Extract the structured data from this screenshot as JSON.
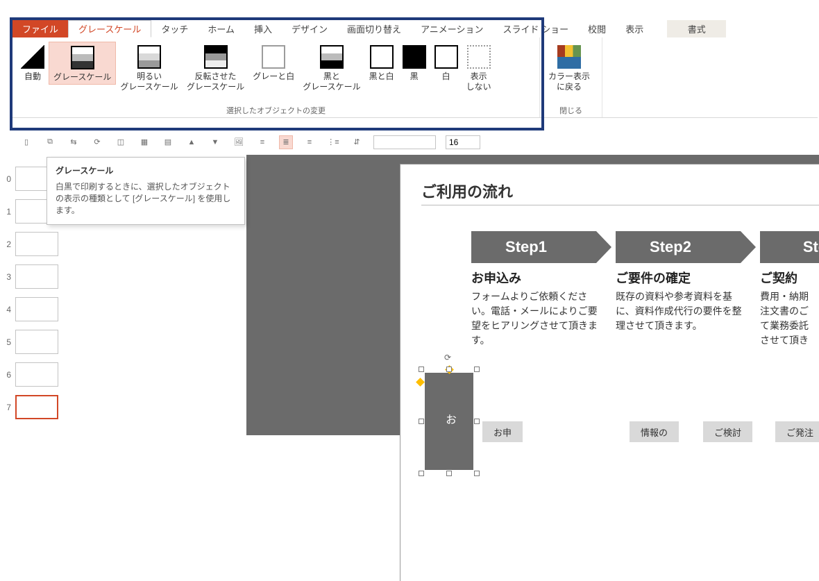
{
  "tabs": {
    "file": "ファイル",
    "grayscale": "グレースケール",
    "touch": "タッチ",
    "home": "ホーム",
    "insert": "挿入",
    "design": "デザイン",
    "transition": "画面切り替え",
    "animation": "アニメーション",
    "slideshow": "スライド ショー",
    "review": "校閲",
    "view": "表示",
    "format": "書式"
  },
  "ribbon": {
    "group1_caption": "選択したオブジェクトの変更",
    "group2_caption": "閉じる",
    "auto": "自動",
    "grayscale": "グレースケール",
    "light_grayscale": "明るい\nグレースケール",
    "inverse_grayscale": "反転させた\nグレースケール",
    "gray_with_white": "グレーと白",
    "black_with_gs": "黒と\nグレースケール",
    "black_with_white": "黒と白",
    "black": "黒",
    "white": "白",
    "dont_show": "表示\nしない",
    "back_to_color": "カラー表示\nに戻る"
  },
  "tooltip": {
    "title": "グレースケール",
    "body": "白黒で印刷するときに、選択したオブジェクトの表示の種類として [グレースケール] を使用します。"
  },
  "thumbs": [
    "0",
    "1",
    "2",
    "3",
    "4",
    "5",
    "6",
    "7"
  ],
  "mini": {
    "font_size": "16"
  },
  "slide": {
    "title": "ご利用の流れ",
    "step_labels": {
      "s1": "Step1",
      "s2": "Step2",
      "s3": "Ste"
    },
    "step_heads": {
      "s1": "お申込み",
      "s2": "ご要件の確定",
      "s3": "ご契約"
    },
    "step_bodies": {
      "s1": "フォームよりご依頼ください。電話・メールによりご要望をヒアリングさせて頂きます。",
      "s2": "既存の資料や参考資料を基に、資料作成代行の要件を整理させて頂きます。",
      "s3": "費用・納期\n注文書のご\nて業務委託\nさせて頂き"
    },
    "vertical_shape_text": "お",
    "grey_buttons": {
      "b1": "お申",
      "b2": "情報の",
      "b3": "ご検討",
      "b4": "ご発注"
    }
  }
}
